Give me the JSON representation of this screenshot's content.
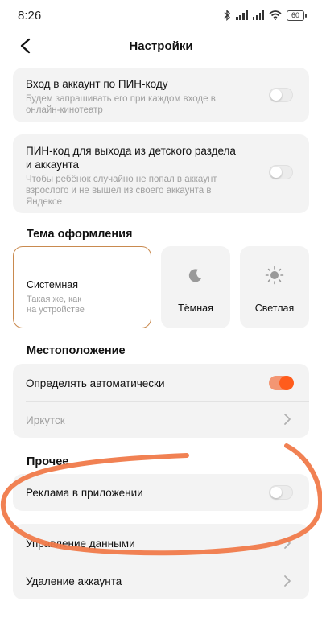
{
  "status_bar": {
    "time": "8:26",
    "battery": "60"
  },
  "header": {
    "title": "Настройки"
  },
  "pin_login": {
    "title": "Вход в аккаунт по ПИН-коду",
    "subtitle_line1": "Будем запрашивать его при каждом входе в",
    "subtitle_line2": "онлайн-кинотеатр",
    "enabled": false
  },
  "pin_kids": {
    "title_line1": "ПИН-код для выхода из детского раздела",
    "title_line2": "и аккаунта",
    "subtitle_line1": "Чтобы ребёнок случайно не попал в аккаунт",
    "subtitle_line2": "взрослого и не вышел из своего аккаунта в",
    "subtitle_line3": "Яндексе",
    "enabled": false
  },
  "theme": {
    "section_title": "Тема оформления",
    "options": [
      {
        "label": "Системная",
        "sub_line1": "Такая же, как",
        "sub_line2": "на устройстве",
        "icon": "none",
        "selected": true
      },
      {
        "label": "Тёмная",
        "icon": "moon-icon",
        "selected": false
      },
      {
        "label": "Светлая",
        "icon": "sun-icon",
        "selected": false
      }
    ]
  },
  "location": {
    "section_title": "Местоположение",
    "auto_label": "Определять автоматически",
    "auto_enabled": true,
    "city": "Иркутск"
  },
  "other": {
    "section_title": "Прочее",
    "ads_label": "Реклама в приложении",
    "ads_enabled": false,
    "data_label": "Управление данными",
    "delete_label": "Удаление аккаунта"
  },
  "colors": {
    "accent": "#ff5c1c",
    "card_bg": "#f3f3f3",
    "selected_border": "#c98a4f",
    "scribble": "#f07a4a"
  }
}
